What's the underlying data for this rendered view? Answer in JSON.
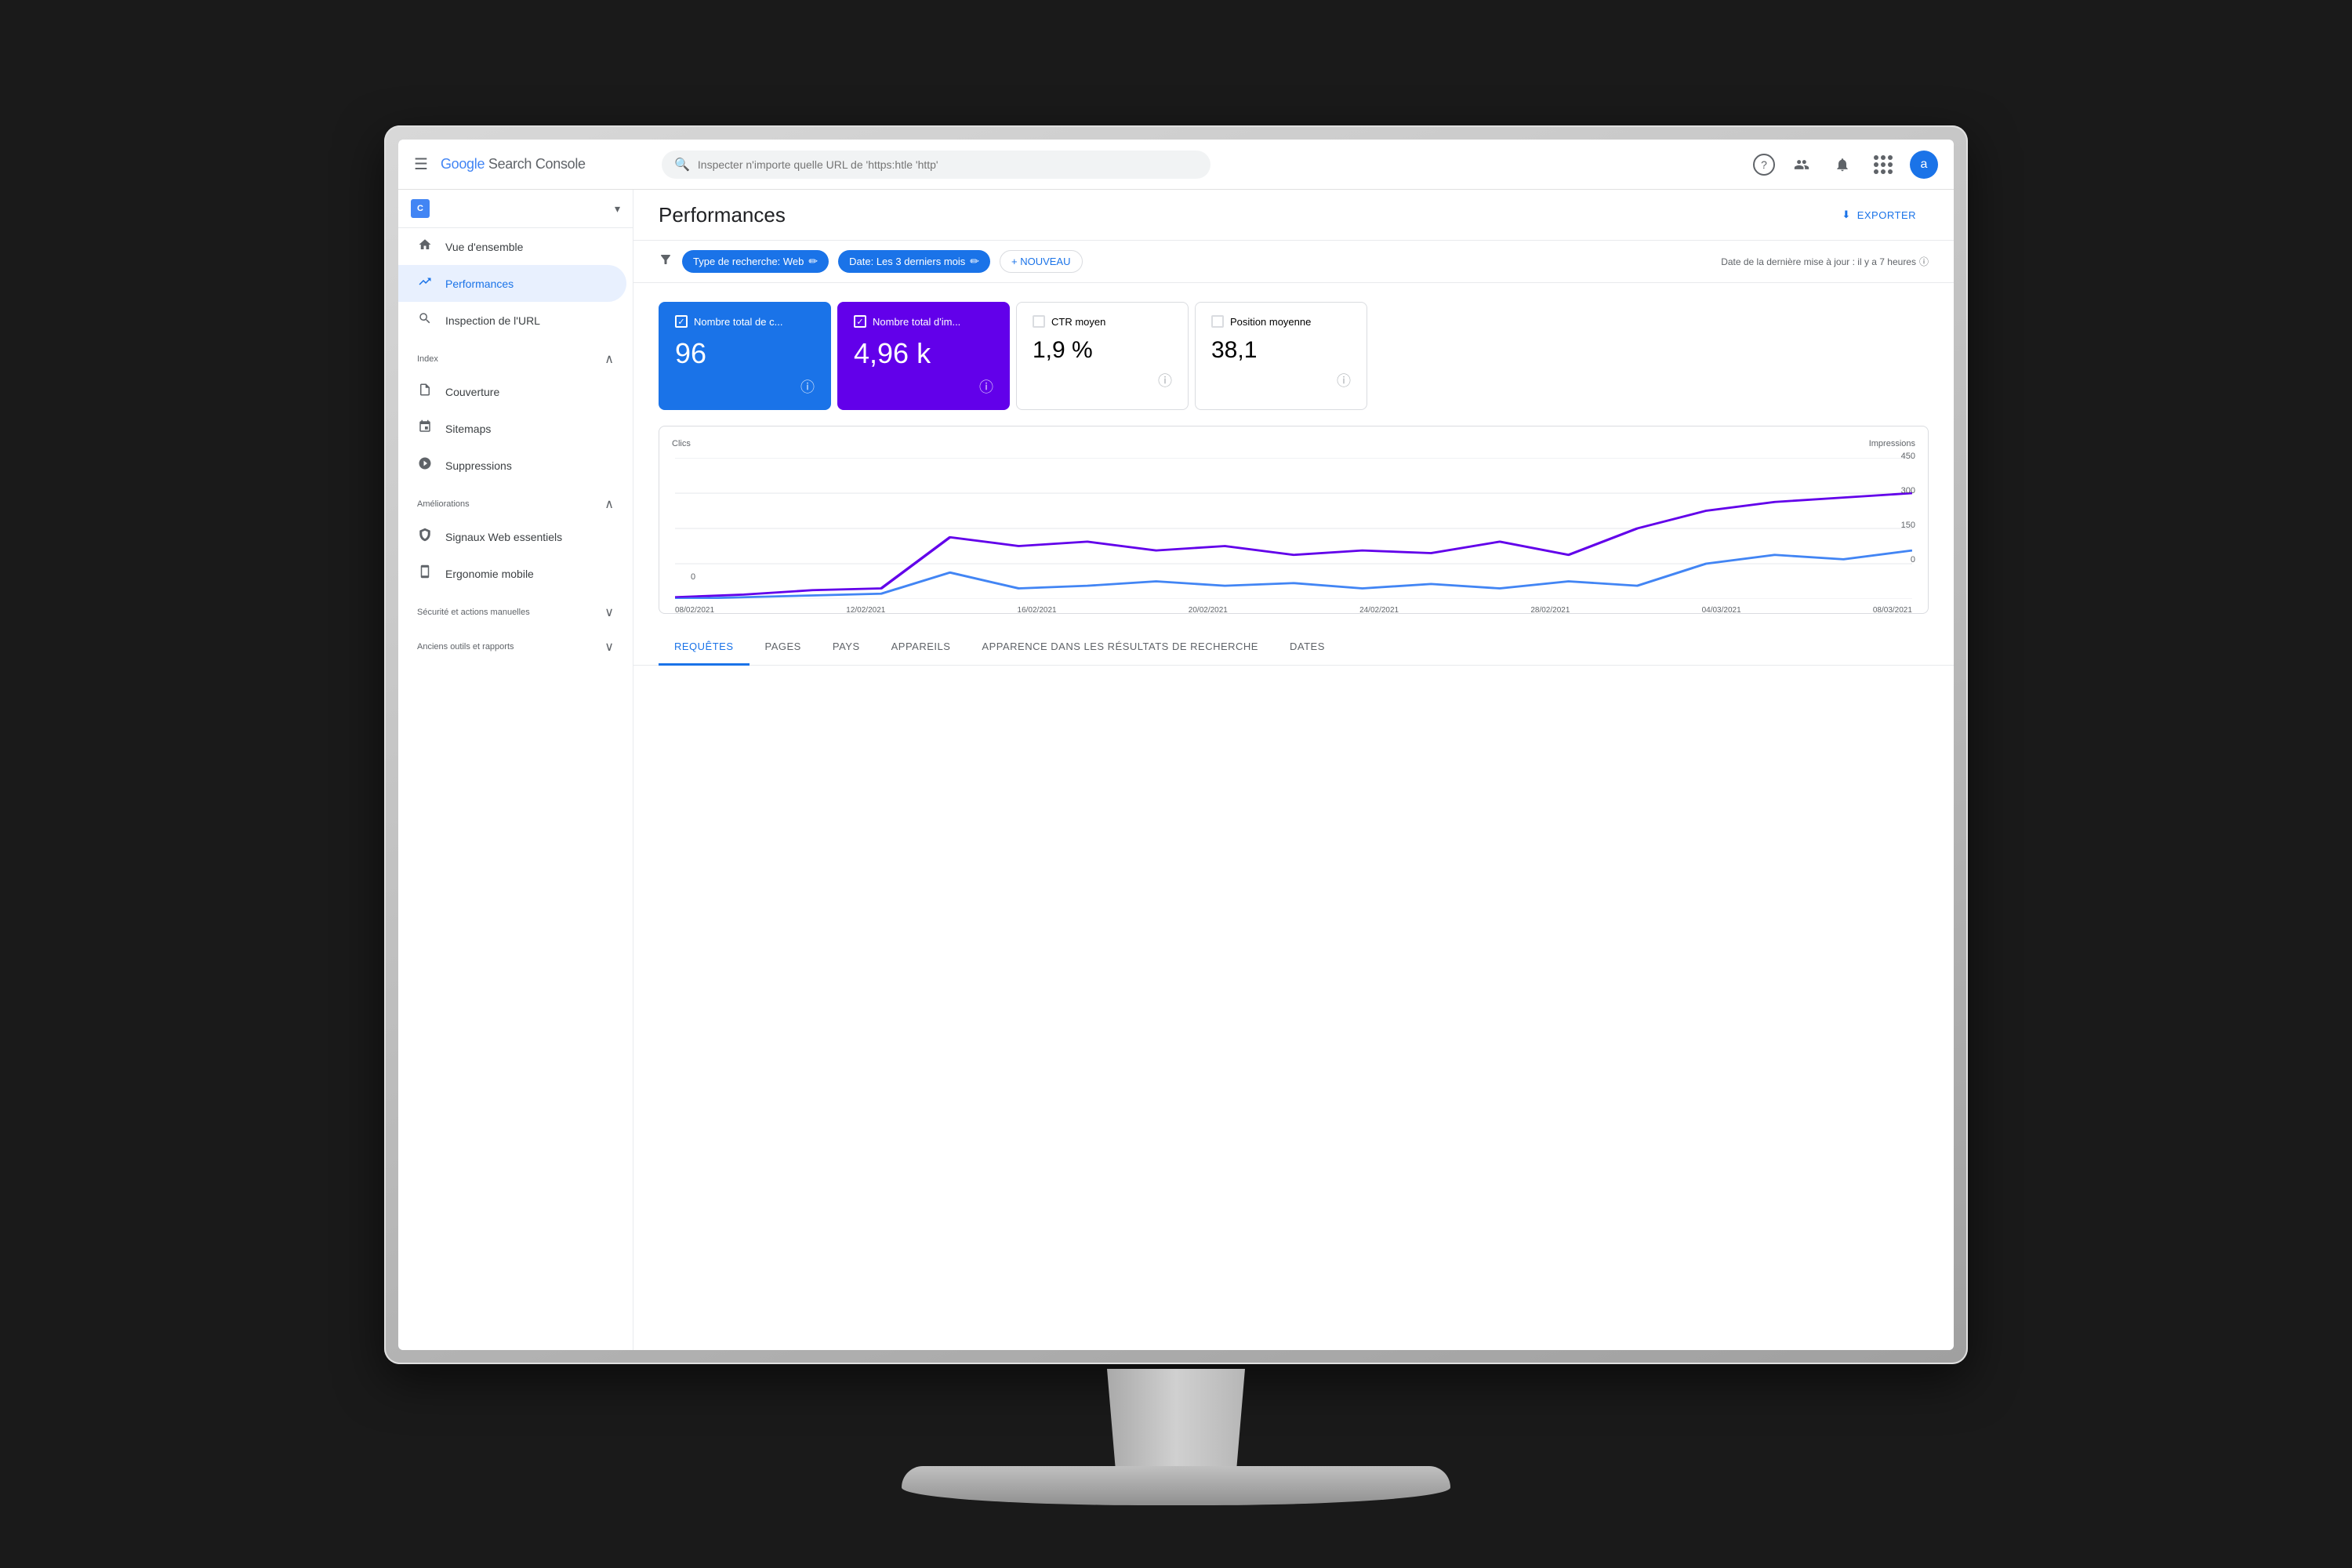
{
  "monitor": {
    "apple_symbol": ""
  },
  "topbar": {
    "logo": "Google Search Console",
    "search_placeholder": "Inspecter n'importe quelle URL de 'https:htle 'http'",
    "help_icon": "?",
    "users_icon": "👤",
    "bell_icon": "🔔",
    "apps_icon": "⋮⋮⋮",
    "avatar_label": "a"
  },
  "sidebar": {
    "property_icon": "C",
    "property_name": "",
    "nav_items": [
      {
        "icon": "🏠",
        "label": "Vue d'ensemble",
        "active": false
      },
      {
        "icon": "📈",
        "label": "Performances",
        "active": true
      },
      {
        "icon": "🔍",
        "label": "Inspection de l'URL",
        "active": false
      }
    ],
    "index_section": "Index",
    "index_items": [
      {
        "icon": "📄",
        "label": "Couverture"
      },
      {
        "icon": "🗺️",
        "label": "Sitemaps"
      },
      {
        "icon": "🚫",
        "label": "Suppressions"
      }
    ],
    "ameliorations_section": "Améliorations",
    "ameliorations_items": [
      {
        "icon": "📱",
        "label": "Signaux Web essentiels"
      },
      {
        "icon": "📱",
        "label": "Ergonomie mobile"
      }
    ],
    "securite_section": "Sécurité et actions manuelles",
    "anciens_section": "Anciens outils et rapports"
  },
  "content": {
    "page_title": "Performances",
    "export_label": "EXPORTER",
    "filter_bar": {
      "search_type_label": "Type de recherche: Web",
      "date_label": "Date: Les 3 derniers mois",
      "new_button": "+ NOUVEAU",
      "update_text": "Date de la dernière mise à jour : il y a 7 heures"
    },
    "metrics": [
      {
        "label": "Nombre total de c...",
        "value": "96",
        "type": "blue",
        "checked": true
      },
      {
        "label": "Nombre total d'im...",
        "value": "4,96 k",
        "type": "purple",
        "checked": true
      },
      {
        "label": "CTR moyen",
        "value": "1,9 %",
        "type": "default",
        "checked": false
      },
      {
        "label": "Position moyenne",
        "value": "38,1",
        "type": "default",
        "checked": false
      }
    ],
    "chart": {
      "left_axis_label": "Clics",
      "right_axis_label": "Impressions",
      "right_values": [
        "450",
        "300",
        "150",
        "0"
      ],
      "left_values": [
        "0"
      ],
      "x_labels": [
        "08/02/2021",
        "12/02/2021",
        "16/02/2021",
        "20/02/2021",
        "24/02/2021",
        "28/02/2021",
        "04/03/2021",
        "08/03/2021"
      ]
    },
    "tabs": [
      {
        "label": "REQUÊTES",
        "active": true
      },
      {
        "label": "PAGES",
        "active": false
      },
      {
        "label": "PAYS",
        "active": false
      },
      {
        "label": "APPAREILS",
        "active": false
      },
      {
        "label": "APPARENCE DANS LES RÉSULTATS DE RECHERCHE",
        "active": false
      },
      {
        "label": "DATES",
        "active": false
      }
    ]
  }
}
